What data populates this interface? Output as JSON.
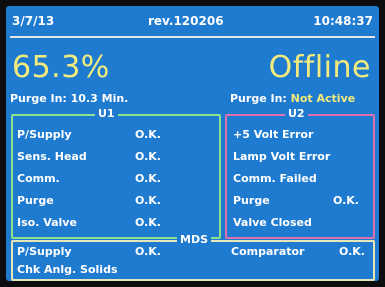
{
  "header": {
    "date": "3/7/13",
    "revision": "rev.120206",
    "time": "10:48:37"
  },
  "left_display": {
    "value": "65.3%",
    "purge_label": "Purge In:",
    "purge_value": "10.3 Min."
  },
  "right_display": {
    "value": "Offline",
    "purge_label": "Purge In:",
    "purge_value": "Not Active"
  },
  "u1": {
    "title": "U1",
    "rows": [
      {
        "label": "P/Supply",
        "status": "O.K."
      },
      {
        "label": "Sens. Head",
        "status": "O.K."
      },
      {
        "label": "Comm.",
        "status": "O.K."
      },
      {
        "label": "Purge",
        "status": "O.K."
      },
      {
        "label": "Iso. Valve",
        "status": "O.K."
      }
    ]
  },
  "u2": {
    "title": "U2",
    "rows": [
      {
        "label": "+5 Volt Error",
        "status": ""
      },
      {
        "label": "Lamp Volt Error",
        "status": ""
      },
      {
        "label": "Comm. Failed",
        "status": ""
      },
      {
        "label": "Purge",
        "status": "O.K."
      },
      {
        "label": "Valve Closed",
        "status": ""
      }
    ]
  },
  "mds": {
    "title": "MDS",
    "psupply_label": "P/Supply",
    "psupply_status": "O.K.",
    "comparator_label": "Comparator",
    "comparator_status": "O.K.",
    "solids_label": "Chk Anlg. Solids"
  },
  "colors": {
    "screen_background": "#1f7bd0",
    "highlight_yellow": "#f3ec7c",
    "u1_border": "#8fe08f",
    "u2_border": "#e06fb2",
    "mds_border": "#e6e6b8"
  }
}
